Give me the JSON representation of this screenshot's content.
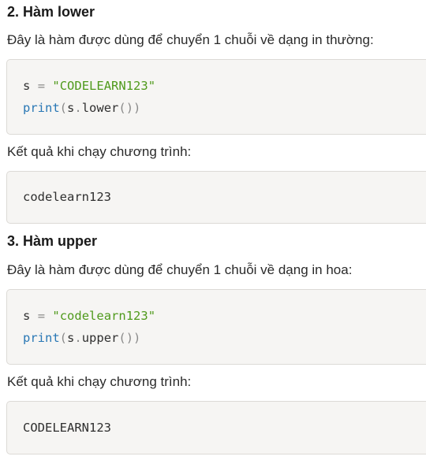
{
  "sections": [
    {
      "heading": "2. Hàm lower",
      "description": "Đây là hàm được dùng để chuyển 1 chuỗi về dạng in thường:",
      "code": {
        "line1": {
          "var": "s",
          "op": "=",
          "string": "\"CODELEARN123\""
        },
        "line2": {
          "fn": "print",
          "open": "(",
          "obj": "s",
          "dot": ".",
          "method": "lower",
          "call": "()",
          "close": ")"
        }
      },
      "result_label": "Kết quả khi chạy chương trình:",
      "output": "codelearn123"
    },
    {
      "heading": "3. Hàm upper",
      "description": "Đây là hàm được dùng để chuyển 1 chuỗi về dạng in hoa:",
      "code": {
        "line1": {
          "var": "s",
          "op": "=",
          "string": "\"codelearn123\""
        },
        "line2": {
          "fn": "print",
          "open": "(",
          "obj": "s",
          "dot": ".",
          "method": "upper",
          "call": "()",
          "close": ")"
        }
      },
      "result_label": "Kết quả khi chạy chương trình:",
      "output": "CODELEARN123"
    }
  ]
}
